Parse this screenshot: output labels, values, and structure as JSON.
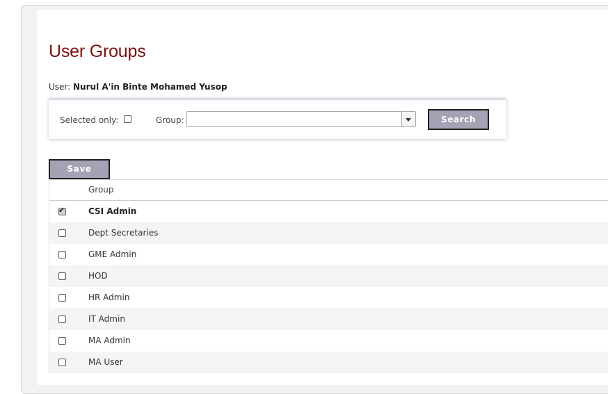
{
  "page": {
    "title": "User Groups"
  },
  "user": {
    "label": "User:",
    "name": "Nurul A'in Binte Mohamed Yusop"
  },
  "filters": {
    "selected_only_label": "Selected only:",
    "selected_only_checked": false,
    "group_label": "Group:",
    "group_value": "",
    "search_label": "Search"
  },
  "actions": {
    "save_label": "Save"
  },
  "table": {
    "column_header": "Group",
    "rows": [
      {
        "label": "CSI Admin",
        "checked": true
      },
      {
        "label": "Dept Secretaries",
        "checked": false
      },
      {
        "label": "GME Admin",
        "checked": false
      },
      {
        "label": "HOD",
        "checked": false
      },
      {
        "label": "HR Admin",
        "checked": false
      },
      {
        "label": "IT Admin",
        "checked": false
      },
      {
        "label": "MA Admin",
        "checked": false
      },
      {
        "label": "MA User",
        "checked": false
      }
    ]
  },
  "colors": {
    "title": "#7b0f10",
    "button_bg": "#a3a3b5",
    "row_alt": "#f4f4f4"
  }
}
